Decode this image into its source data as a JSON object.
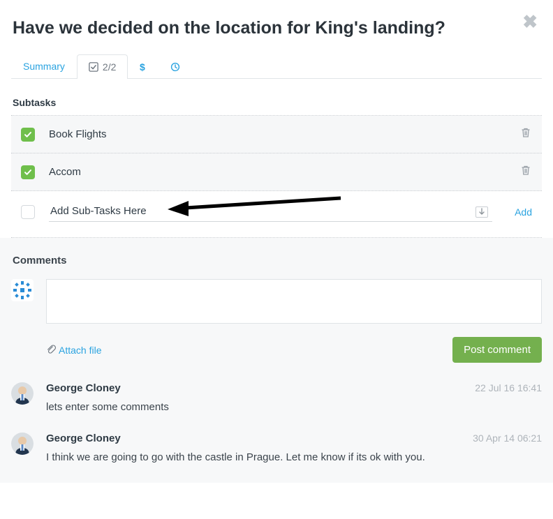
{
  "title": "Have we decided on the location for King's landing?",
  "tabs": {
    "summary": "Summary",
    "subtasks_badge": "2/2"
  },
  "subtasks": {
    "heading": "Subtasks",
    "items": [
      {
        "label": "Book Flights"
      },
      {
        "label": "Accom"
      }
    ],
    "add_placeholder": "Add Sub-Tasks Here",
    "add_link": "Add"
  },
  "comments": {
    "heading": "Comments",
    "attach_label": "Attach file",
    "post_label": "Post comment",
    "items": [
      {
        "author": "George Cloney",
        "date": "22 Jul 16 16:41",
        "text": "lets enter some comments"
      },
      {
        "author": "George Cloney",
        "date": "30 Apr 14 06:21",
        "text": "I think we are going to go with the castle in Prague. Let me know if its ok with you."
      }
    ]
  }
}
